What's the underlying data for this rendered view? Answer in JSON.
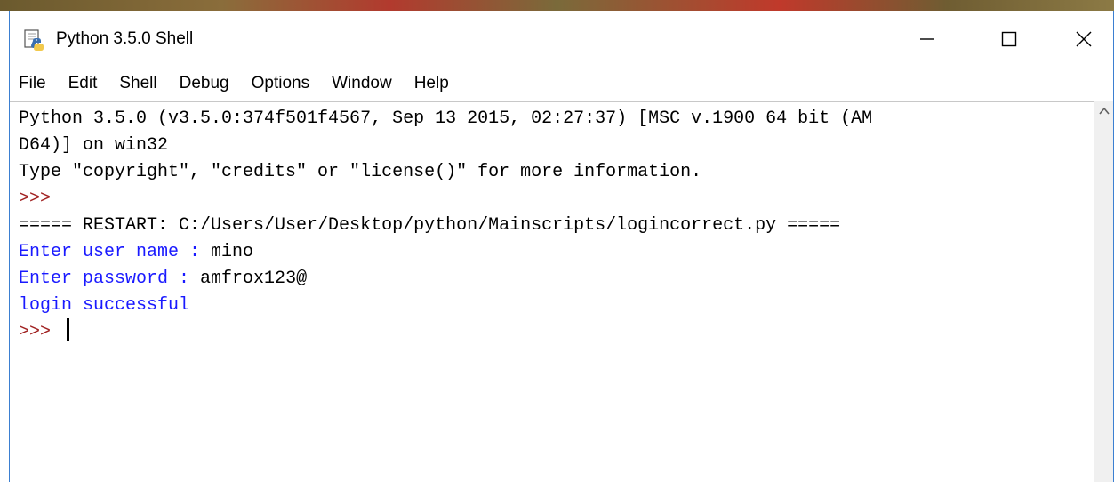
{
  "window": {
    "title": "Python 3.5.0 Shell",
    "icon": "python-idle-icon",
    "controls": {
      "minimize_icon": "minimize-icon",
      "maximize_icon": "maximize-icon",
      "close_icon": "close-icon"
    }
  },
  "menu": {
    "items": [
      {
        "label": "File"
      },
      {
        "label": "Edit"
      },
      {
        "label": "Shell"
      },
      {
        "label": "Debug"
      },
      {
        "label": "Options"
      },
      {
        "label": "Window"
      },
      {
        "label": "Help"
      }
    ]
  },
  "shell": {
    "banner_line1": "Python 3.5.0 (v3.5.0:374f501f4567, Sep 13 2015, 02:27:37) [MSC v.1900 64 bit (AM",
    "banner_line2": "D64)] on win32",
    "banner_line3": "Type \"copyright\", \"credits\" or \"license()\" for more information.",
    "prompt": ">>>",
    "restart_line": "===== RESTART: C:/Users/User/Desktop/python/Mainscripts/logincorrect.py =====",
    "username_prompt": "Enter user name : ",
    "username_value": "mino",
    "password_prompt": "Enter password : ",
    "password_value": "amfrox123@",
    "result": "login successful",
    "final_prompt": ">>> "
  },
  "colors": {
    "prompt": "#a02020",
    "program_output": "#1a1aff",
    "user_input": "#000000",
    "window_border": "#3b7fd1"
  }
}
